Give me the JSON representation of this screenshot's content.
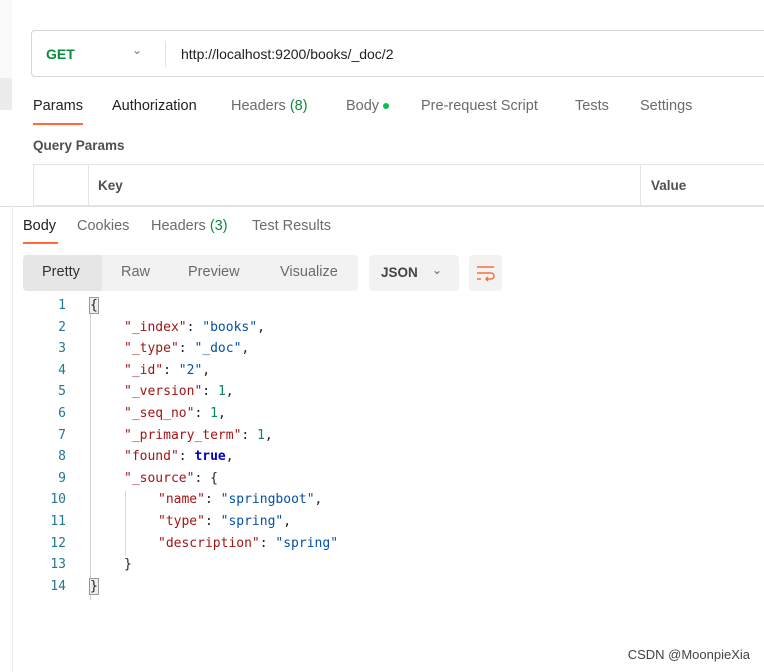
{
  "request": {
    "method": "GET",
    "url": "http://localhost:9200/books/_doc/2"
  },
  "request_tabs": [
    {
      "label": "Params"
    },
    {
      "label": "Authorization"
    },
    {
      "label": "Headers",
      "count": "(8)"
    },
    {
      "label": "Body"
    },
    {
      "label": "Pre-request Script"
    },
    {
      "label": "Tests"
    },
    {
      "label": "Settings"
    }
  ],
  "query_params": {
    "title": "Query Params",
    "columns": [
      "Key",
      "Value"
    ]
  },
  "response_tabs": [
    {
      "label": "Body"
    },
    {
      "label": "Cookies"
    },
    {
      "label": "Headers",
      "count": "(3)"
    },
    {
      "label": "Test Results"
    }
  ],
  "view_modes": [
    "Pretty",
    "Raw",
    "Preview",
    "Visualize"
  ],
  "format": "JSON",
  "wrap_icon": "wrap-lines-icon",
  "colors": {
    "accent": "#ff6c37",
    "key": "#a31515",
    "string": "#0451a5",
    "number": "#098658"
  },
  "code_lines": [
    {
      "n": "1",
      "indent": 0,
      "t": [
        [
          "brk",
          "{"
        ]
      ]
    },
    {
      "n": "2",
      "indent": 1,
      "t": [
        [
          "key",
          "\"_index\""
        ],
        [
          "pun",
          ": "
        ],
        [
          "str",
          "\"books\""
        ],
        [
          "pun",
          ","
        ]
      ]
    },
    {
      "n": "3",
      "indent": 1,
      "t": [
        [
          "key",
          "\"_type\""
        ],
        [
          "pun",
          ": "
        ],
        [
          "str",
          "\"_doc\""
        ],
        [
          "pun",
          ","
        ]
      ]
    },
    {
      "n": "4",
      "indent": 1,
      "t": [
        [
          "key",
          "\"_id\""
        ],
        [
          "pun",
          ": "
        ],
        [
          "str",
          "\"2\""
        ],
        [
          "pun",
          ","
        ]
      ]
    },
    {
      "n": "5",
      "indent": 1,
      "t": [
        [
          "key",
          "\"_version\""
        ],
        [
          "pun",
          ": "
        ],
        [
          "num",
          "1"
        ],
        [
          "pun",
          ","
        ]
      ]
    },
    {
      "n": "6",
      "indent": 1,
      "t": [
        [
          "key",
          "\"_seq_no\""
        ],
        [
          "pun",
          ": "
        ],
        [
          "num",
          "1"
        ],
        [
          "pun",
          ","
        ]
      ]
    },
    {
      "n": "7",
      "indent": 1,
      "t": [
        [
          "key",
          "\"_primary_term\""
        ],
        [
          "pun",
          ": "
        ],
        [
          "num",
          "1"
        ],
        [
          "pun",
          ","
        ]
      ]
    },
    {
      "n": "8",
      "indent": 1,
      "t": [
        [
          "key",
          "\"found\""
        ],
        [
          "pun",
          ": "
        ],
        [
          "bool",
          "true"
        ],
        [
          "pun",
          ","
        ]
      ]
    },
    {
      "n": "9",
      "indent": 1,
      "t": [
        [
          "key",
          "\"_source\""
        ],
        [
          "pun",
          ": {"
        ]
      ]
    },
    {
      "n": "10",
      "indent": 2,
      "t": [
        [
          "key",
          "\"name\""
        ],
        [
          "pun",
          ": "
        ],
        [
          "str",
          "\"springboot\""
        ],
        [
          "pun",
          ","
        ]
      ]
    },
    {
      "n": "11",
      "indent": 2,
      "t": [
        [
          "key",
          "\"type\""
        ],
        [
          "pun",
          ": "
        ],
        [
          "str",
          "\"spring\""
        ],
        [
          "pun",
          ","
        ]
      ]
    },
    {
      "n": "12",
      "indent": 2,
      "t": [
        [
          "key",
          "\"description\""
        ],
        [
          "pun",
          ": "
        ],
        [
          "str",
          "\"spring\""
        ]
      ]
    },
    {
      "n": "13",
      "indent": 1,
      "t": [
        [
          "pun",
          "}"
        ]
      ]
    },
    {
      "n": "14",
      "indent": 0,
      "t": [
        [
          "brk",
          "}"
        ]
      ]
    }
  ],
  "watermark": "CSDN @MoonpieXia"
}
